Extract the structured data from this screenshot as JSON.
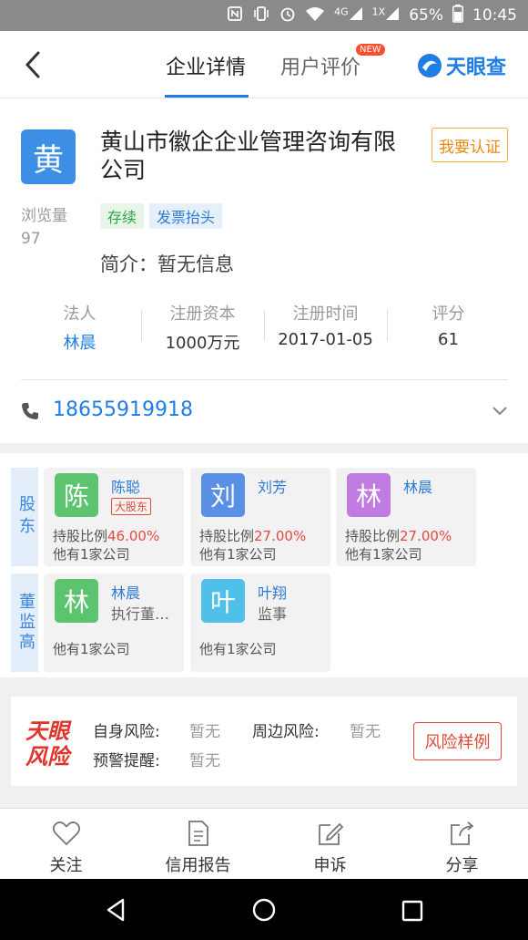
{
  "status_bar": {
    "network": "4G",
    "signal2": "1X",
    "battery": "65%",
    "time": "10:45"
  },
  "header": {
    "tabs": [
      {
        "label": "企业详情",
        "active": true
      },
      {
        "label": "用户评价",
        "active": false
      }
    ],
    "new_badge": "NEW",
    "brand": "天眼查"
  },
  "company": {
    "logo_char": "黄",
    "name": "黄山市徽企企业管理咨询有限公司",
    "verify_label": "我要认证",
    "views_label": "浏览量",
    "views_value": "97",
    "tags": [
      "存续",
      "发票抬头"
    ],
    "intro": "简介：暂无信息",
    "stats": [
      {
        "label": "法人",
        "value": "林晨"
      },
      {
        "label": "注册资本",
        "value": "1000万元"
      },
      {
        "label": "注册时间",
        "value": "2017-01-05"
      },
      {
        "label": "评分",
        "value": "61"
      }
    ],
    "phone": "18655919918"
  },
  "shareholders": {
    "label": "股东",
    "items": [
      {
        "avatar": "陈",
        "name": "陈聪",
        "badge": "大股东",
        "share_label": "持股比例",
        "share": "46.00%",
        "other": "他有1家公司",
        "color": "#5cc36e"
      },
      {
        "avatar": "刘",
        "name": "刘芳",
        "share_label": "持股比例",
        "share": "27.00%",
        "other": "他有1家公司",
        "color": "#5a8fe6"
      },
      {
        "avatar": "林",
        "name": "林晨",
        "share_label": "持股比例",
        "share": "27.00%",
        "other": "他有1家公司",
        "color": "#c07be0"
      }
    ]
  },
  "executives": {
    "label": "董监高",
    "items": [
      {
        "avatar": "林",
        "name": "林晨",
        "role": "执行董事...",
        "other": "他有1家公司",
        "color": "#5cc36e"
      },
      {
        "avatar": "叶",
        "name": "叶翔",
        "role": "监事",
        "other": "他有1家公司",
        "color": "#4ec0ea"
      }
    ]
  },
  "risk": {
    "self_label": "自身风险:",
    "self_value": "暂无",
    "around_label": "周边风险:",
    "around_value": "暂无",
    "warn_label": "预警提醒:",
    "warn_value": "暂无",
    "button": "风险样例",
    "logo_text": [
      "天眼",
      "风险"
    ]
  },
  "bottom_tabs": [
    {
      "label": "关注",
      "icon": "heart-icon"
    },
    {
      "label": "信用报告",
      "icon": "document-icon"
    },
    {
      "label": "申诉",
      "icon": "edit-icon"
    },
    {
      "label": "分享",
      "icon": "share-icon"
    }
  ]
}
